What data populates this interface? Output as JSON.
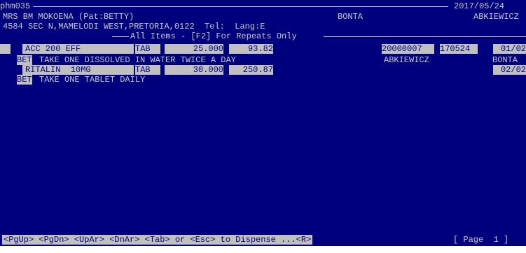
{
  "screen": {
    "program_id": "phm035",
    "date": "2017/05/24",
    "patient_line": "MRS BM MOKOENA (Pat:BETTY)",
    "doctor_short": "BONTA",
    "doctor_right": "ABKIEWICZ",
    "address_line": "4584 SEC N,MAMELODI WEST,PRETORIA,0122  Tel:  Lang:E",
    "section_title": "All Items - [F2] For Repeats Only"
  },
  "items": [
    {
      "marker": " ",
      "name": "ACC 200 EFF",
      "unit": "TAB",
      "qty": "25.000",
      "price": "93.82",
      "script_no": "20000007",
      "script_date": "170524",
      "repeat": "01/02",
      "instr_code": "BET",
      "instruction": "TAKE ONE DISSOLVED IN WATER TWICE A DAY",
      "prescriber": "ABKIEWICZ",
      "doctor": "BONTA"
    },
    {
      "marker": "",
      "name": "RITALIN  10MG",
      "unit": "TAB",
      "qty": "30.000",
      "price": "250.87",
      "repeat": "02/02",
      "instr_code": "BET",
      "instruction": "TAKE ONE TABLET DAILY"
    }
  ],
  "footer": {
    "keys": "<PgUp> <PgDn> <UpAr> <DnAr> <Tab> or <Esc> to Dispense ...<R>",
    "page": "[ Page  1 ]"
  },
  "colors": {
    "background": "#00007f",
    "text": "#c8c8c8",
    "highlight_bg": "#c0c0c0",
    "highlight_text": "#00007f"
  }
}
